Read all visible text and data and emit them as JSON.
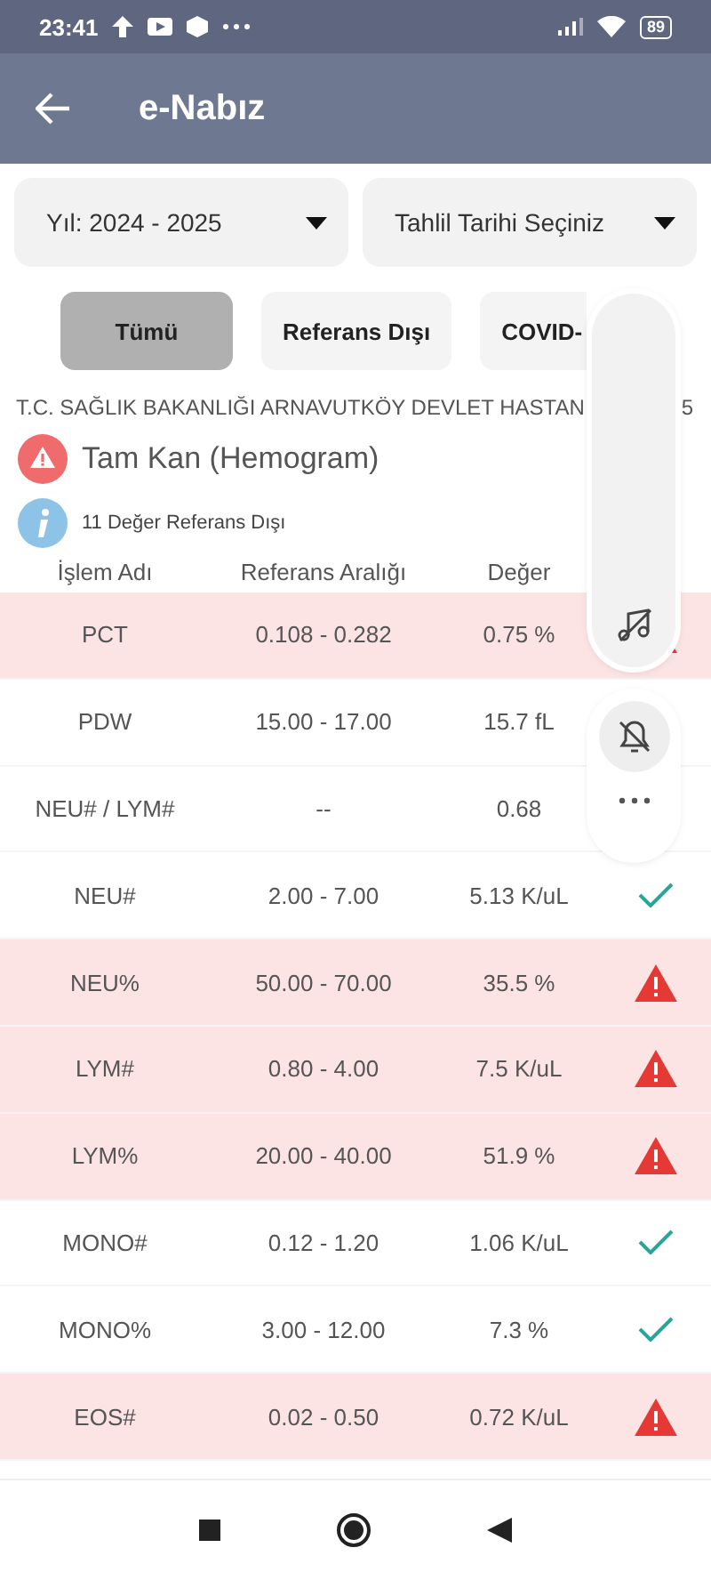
{
  "status_bar": {
    "time": "23:41",
    "battery": "89"
  },
  "app_bar": {
    "title": "e-Nabız"
  },
  "dropdowns": [
    {
      "label": "Yıl: 2024 - 2025"
    },
    {
      "label": "Tahlil Tarihi Seçiniz"
    }
  ],
  "filters": [
    {
      "label": "Tümü",
      "selected": true
    },
    {
      "label": "Referans Dışı",
      "selected": false
    },
    {
      "label": "COVID-",
      "selected": false
    }
  ],
  "report": {
    "hospital": "T.C. SAĞLIK BAKANLIĞI ARNAVUTKÖY DEVLET HASTAN",
    "date_fragment": "5",
    "test_name": "Tam Kan (Hemogram)",
    "summary": "11 Değer Referans Dışı"
  },
  "table": {
    "columns": [
      "İşlem Adı",
      "Referans Aralığı",
      "Değer"
    ],
    "rows": [
      {
        "name": "PCT",
        "range": "0.108 - 0.282",
        "value": "0.75 %",
        "out_of_range": true,
        "kind": "alert"
      },
      {
        "name": "PDW",
        "range": "15.00 - 17.00",
        "value": "15.7 fL",
        "out_of_range": false,
        "kind": "covered"
      },
      {
        "name": "NEU# / LYM#",
        "range": "--",
        "value": "0.68",
        "out_of_range": false,
        "kind": "covered"
      },
      {
        "name": "NEU#",
        "range": "2.00 - 7.00",
        "value": "5.13 K/uL",
        "out_of_range": false,
        "kind": "ok"
      },
      {
        "name": "NEU%",
        "range": "50.00 - 70.00",
        "value": "35.5 %",
        "out_of_range": true,
        "kind": "alert"
      },
      {
        "name": "LYM#",
        "range": "0.80 - 4.00",
        "value": "7.5 K/uL",
        "out_of_range": true,
        "kind": "alert"
      },
      {
        "name": "LYM%",
        "range": "20.00 - 40.00",
        "value": "51.9 %",
        "out_of_range": true,
        "kind": "alert"
      },
      {
        "name": "MONO#",
        "range": "0.12 - 1.20",
        "value": "1.06 K/uL",
        "out_of_range": false,
        "kind": "ok"
      },
      {
        "name": "MONO%",
        "range": "3.00 - 12.00",
        "value": "7.3 %",
        "out_of_range": false,
        "kind": "ok"
      },
      {
        "name": "EOS#",
        "range": "0.02 - 0.50",
        "value": "0.72 K/uL",
        "out_of_range": true,
        "kind": "alert"
      }
    ]
  }
}
